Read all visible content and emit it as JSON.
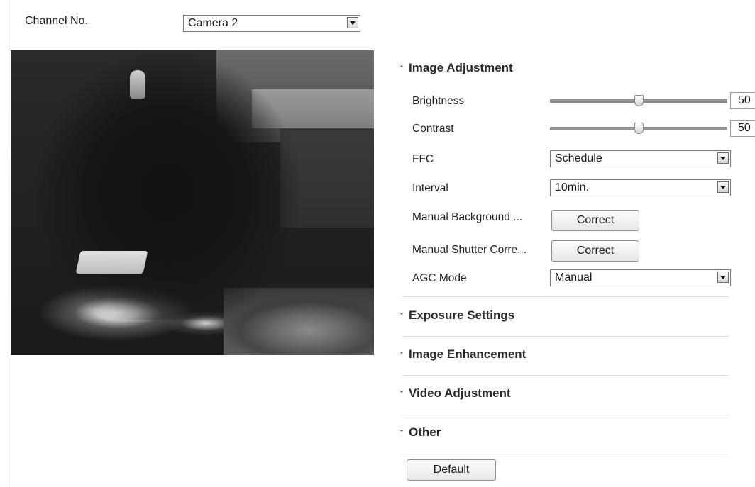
{
  "channel": {
    "label": "Channel No.",
    "value": "Camera 2"
  },
  "sections": {
    "image_adjustment": {
      "title": "Image Adjustment",
      "brightness": {
        "label": "Brightness",
        "value": "50",
        "fraction": 0.5
      },
      "contrast": {
        "label": "Contrast",
        "value": "50",
        "fraction": 0.5
      },
      "ffc": {
        "label": "FFC",
        "value": "Schedule"
      },
      "interval": {
        "label": "Interval",
        "value": "10min."
      },
      "manual_background": {
        "label": "Manual Background ...",
        "button": "Correct"
      },
      "manual_shutter": {
        "label": "Manual Shutter Corre...",
        "button": "Correct"
      },
      "agc_mode": {
        "label": "AGC Mode",
        "value": "Manual"
      }
    },
    "exposure_settings": {
      "title": "Exposure Settings"
    },
    "image_enhancement": {
      "title": "Image Enhancement"
    },
    "video_adjustment": {
      "title": "Video Adjustment"
    },
    "other": {
      "title": "Other"
    }
  },
  "default_button": "Default",
  "icons": {
    "expanded": "chevron-up-icon",
    "collapsed": "chevron-down-icon"
  }
}
